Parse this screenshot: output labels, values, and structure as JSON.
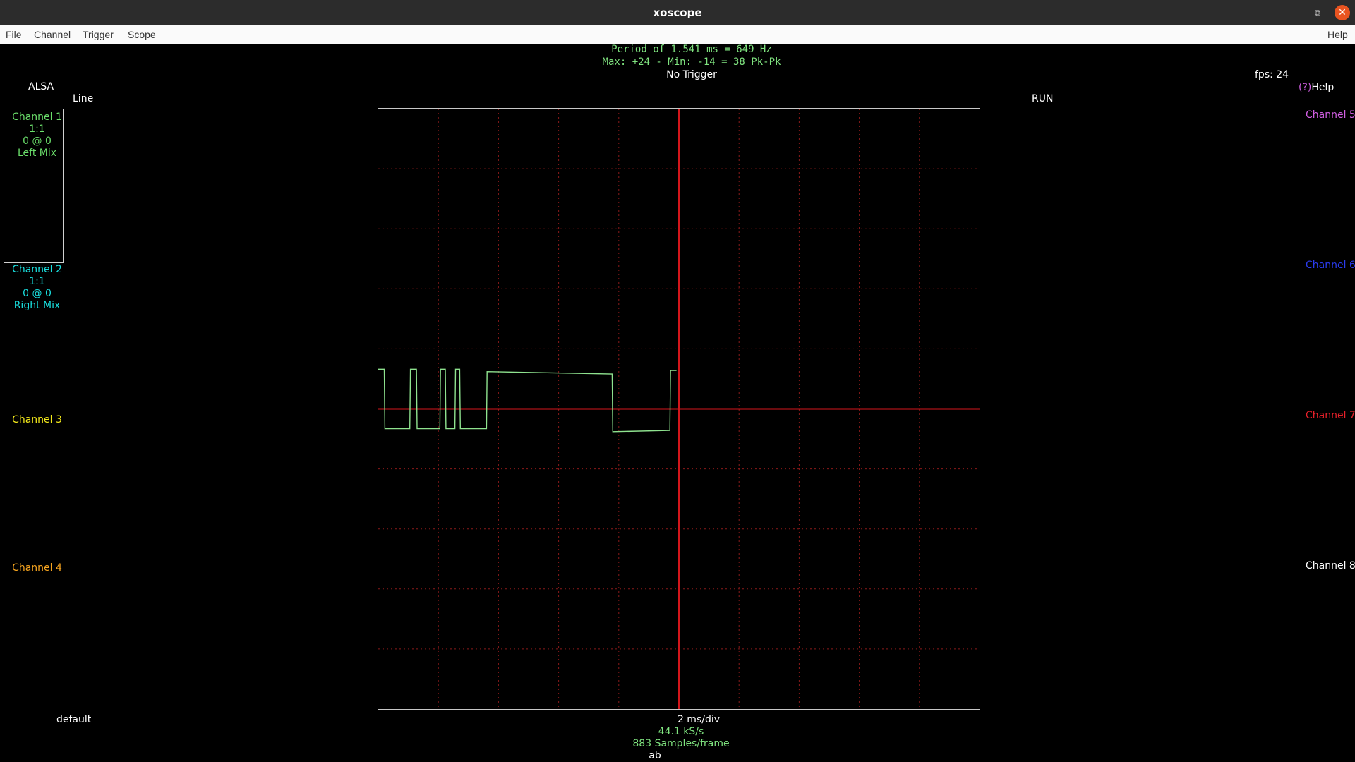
{
  "window": {
    "title": "xoscope",
    "minimize_icon": "–",
    "maximize_icon": "⧉",
    "close_icon": "✕"
  },
  "menu": {
    "items": [
      "File",
      "Channel",
      "Trigger",
      "Scope"
    ],
    "help": "Help"
  },
  "readout": {
    "period": "Period of 1.541 ms =   649 Hz",
    "maxmin": "Max: +24 - Min: -14 =  38 Pk-Pk",
    "trigger": "No Trigger"
  },
  "status": {
    "source": "ALSA",
    "mode": "Line",
    "run": "RUN",
    "fps": "fps: 24",
    "help_key": "(?)",
    "help_label": "Help",
    "preset": "default"
  },
  "channels_left": {
    "ch1": {
      "name": "Channel 1",
      "scale": "1:1",
      "pos": "0 @ 0",
      "source": "Left Mix"
    },
    "ch2": {
      "name": "Channel 2",
      "scale": "1:1",
      "pos": "0 @ 0",
      "source": "Right Mix"
    },
    "ch3": {
      "name": "Channel 3"
    },
    "ch4": {
      "name": "Channel 4"
    }
  },
  "channels_right": {
    "ch5": {
      "name": "Channel 5"
    },
    "ch6": {
      "name": "Channel 6"
    },
    "ch7": {
      "name": "Channel 7"
    },
    "ch8": {
      "name": "Channel 8"
    }
  },
  "timebase": {
    "per_div": "2 ms/div",
    "rate": "44.1 kS/s",
    "samples": "883 Samples/frame",
    "mode": "ab"
  },
  "colors": {
    "ch1": "#6bdf6b",
    "ch2": "#19dfdf",
    "ch3": "#f2e81a",
    "ch4": "#f7a51f",
    "ch5": "#d25fe3",
    "ch6": "#2a3cf0",
    "ch7": "#e8202a",
    "ch8": "#ffffff",
    "grid": "#8b1a1a",
    "axis": "#d4161b",
    "trace": "#8fe38f"
  },
  "chart_data": {
    "type": "line",
    "title": "",
    "xlabel": "",
    "ylabel": "",
    "x_divisions": 10,
    "y_divisions": 10,
    "ms_per_div": 2,
    "xlim": [
      0,
      20
    ],
    "ylim": [
      -5,
      5
    ],
    "grid": true,
    "series": [
      {
        "x": [
          0,
          0.2,
          0.22,
          1.05,
          1.07,
          1.27,
          1.29,
          2.05,
          2.07,
          2.23,
          2.25,
          2.55,
          2.57,
          2.71,
          2.73,
          3.6,
          3.62,
          7.78,
          7.8,
          9.7,
          9.72,
          9.92
        ],
        "y": [
          0.66,
          0.66,
          -0.33,
          -0.33,
          0.66,
          0.66,
          -0.33,
          -0.33,
          0.66,
          0.66,
          -0.33,
          -0.33,
          0.66,
          0.66,
          -0.33,
          -0.33,
          0.62,
          0.58,
          -0.38,
          -0.36,
          0.64,
          0.64
        ]
      }
    ]
  }
}
